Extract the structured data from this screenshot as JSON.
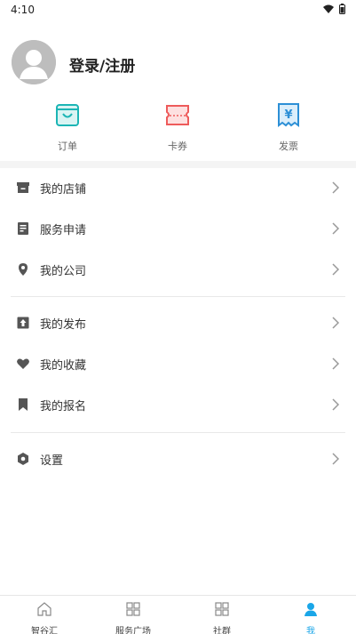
{
  "status": {
    "time": "4:10"
  },
  "profile": {
    "login_label": "登录/注册"
  },
  "quick_actions": [
    {
      "label": "订单",
      "icon": "shopping-bag-icon",
      "color": "#1cb5b5"
    },
    {
      "label": "卡券",
      "icon": "ticket-icon",
      "color": "#ee5b5b"
    },
    {
      "label": "发票",
      "icon": "invoice-icon",
      "color": "#2c8fd6"
    }
  ],
  "menu": {
    "group1": [
      {
        "label": "我的店铺",
        "icon": "store-icon"
      },
      {
        "label": "服务申请",
        "icon": "form-icon"
      },
      {
        "label": "我的公司",
        "icon": "location-pin-icon"
      }
    ],
    "group2": [
      {
        "label": "我的发布",
        "icon": "upload-icon"
      },
      {
        "label": "我的收藏",
        "icon": "heart-icon"
      },
      {
        "label": "我的报名",
        "icon": "bookmark-icon"
      }
    ],
    "group3": [
      {
        "label": "设置",
        "icon": "settings-icon"
      }
    ]
  },
  "tabbar": {
    "items": [
      {
        "label": "智谷汇",
        "icon": "home-icon"
      },
      {
        "label": "服务广场",
        "icon": "grid-icon"
      },
      {
        "label": "社群",
        "icon": "grid-icon"
      },
      {
        "label": "我",
        "icon": "user-icon",
        "active": true
      }
    ],
    "active_color": "#1aa6e8"
  }
}
